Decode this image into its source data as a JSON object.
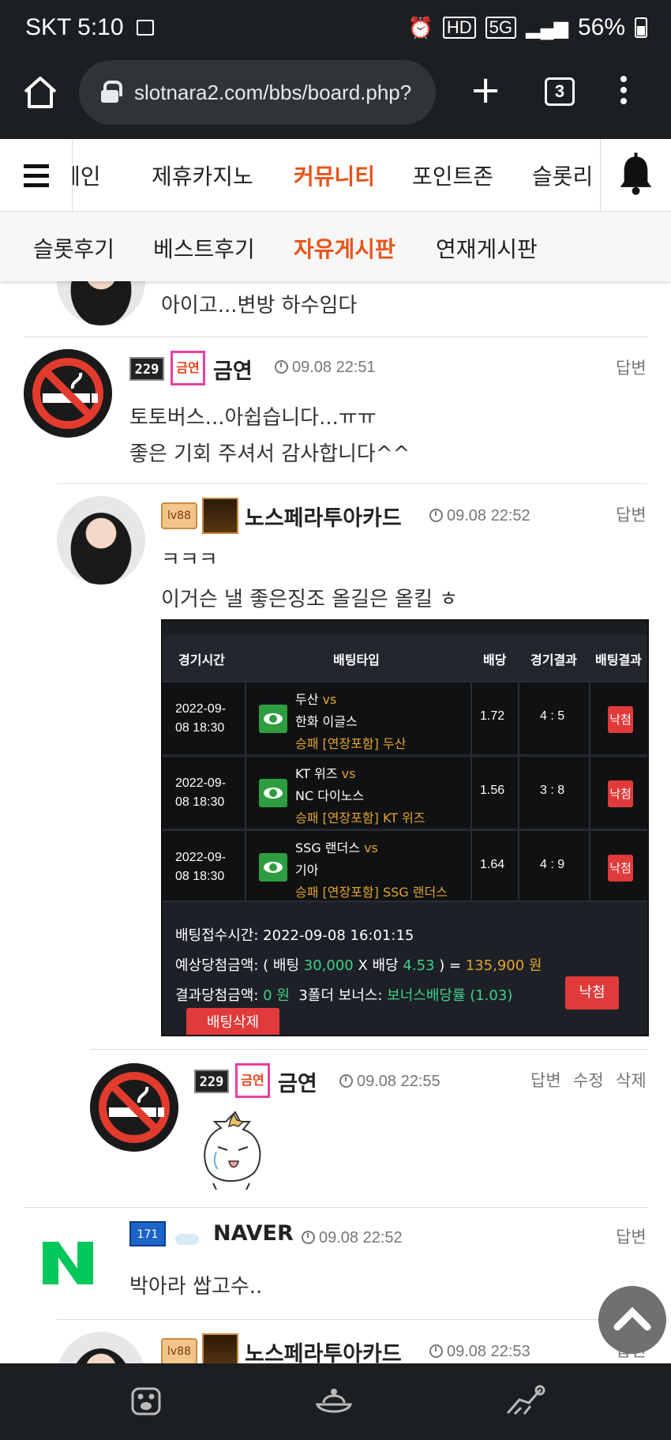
{
  "status_bar": {
    "carrier_time": "SKT 5:10",
    "hd_label": "HD",
    "network": "5G",
    "battery": "56%"
  },
  "browser": {
    "url": "slotnara2.com/bbs/board.php?",
    "tab_count": "3"
  },
  "site_nav": {
    "items": [
      {
        "label": "메인",
        "active": false
      },
      {
        "label": "제휴카지노",
        "active": false
      },
      {
        "label": "커뮤니티",
        "active": true
      },
      {
        "label": "포인트존",
        "active": false
      },
      {
        "label": "슬롯리",
        "active": false
      }
    ],
    "accent_color": "#e8541a"
  },
  "sub_nav": {
    "items": [
      {
        "label": "슬롯후기",
        "active": false
      },
      {
        "label": "베스트후기",
        "active": false
      },
      {
        "label": "자유게시판",
        "active": true
      },
      {
        "label": "연재게시판",
        "active": false
      }
    ]
  },
  "comments": [
    {
      "avatar": "girl-avatar",
      "text": "아이고...변방 하수임다"
    },
    {
      "avatar": "no-smoking-avatar",
      "level": "229",
      "badge": "금연",
      "nick": "금연",
      "time": "09.08 22:51",
      "actions": [
        "답변"
      ],
      "lines": [
        "토토버스...아쉽습니다...ㅠㅠ",
        "좋은 기회 주셔서 감사합니다^^"
      ]
    },
    {
      "avatar": "girl-avatar",
      "level": "lv88",
      "nick": "노스페라투아카드",
      "time": "09.08 22:52",
      "actions": [
        "답변"
      ],
      "lines": [
        "ㅋㅋㅋ",
        "이거슨 낼 좋은징조 올길은 올킬 ㅎ"
      ]
    },
    {
      "avatar": "no-smoking-avatar",
      "level": "229",
      "badge": "금연",
      "nick": "금연",
      "time": "09.08 22:55",
      "actions": [
        "답변",
        "수정",
        "삭제"
      ]
    },
    {
      "avatar": "naver-avatar",
      "level": "171",
      "nick": "NAVER",
      "time": "09.08 22:52",
      "actions": [
        "답변"
      ],
      "lines": [
        "박아라 쌉고수.."
      ]
    },
    {
      "avatar": "girl-avatar",
      "level": "lv88",
      "nick": "노스페라투아카드",
      "time": "09.08 22:53",
      "actions": [
        "답변"
      ]
    }
  ],
  "bet_slip": {
    "headers": [
      "경기시간",
      "배팅타입",
      "배당",
      "경기결과",
      "배팅결과"
    ],
    "rows": [
      {
        "date1": "2022-09-",
        "date2": "08 18:30",
        "home": "두산",
        "vs": "vs",
        "away": "한화 이글스",
        "pick": "승패 [연장포함] 두산",
        "odds": "1.72",
        "score": "4 : 5",
        "result": "낙첨"
      },
      {
        "date1": "2022-09-",
        "date2": "08 18:30",
        "home": "KT 위즈",
        "vs": "vs",
        "away": "NC 다이노스",
        "pick": "승패 [연장포함] KT 위즈",
        "odds": "1.56",
        "score": "3 : 8",
        "result": "낙첨"
      },
      {
        "date1": "2022-09-",
        "date2": "08 18:30",
        "home": "SSG 랜더스",
        "vs": "vs",
        "away": "기아",
        "pick": "승패 [연장포함] SSG 랜더스",
        "odds": "1.64",
        "score": "4 : 9",
        "result": "낙첨"
      }
    ],
    "received_label": "배팅접수시간:",
    "received_time": "2022-09-08 16:01:15",
    "expected_label": "예상당첨금액: ( 배팅",
    "stake": "30,000",
    "x_label": "X 배당",
    "total_odds": "4.53",
    "eq_label": ") =",
    "expected_win": "135,900 원",
    "result_label": "결과당첨금액:",
    "result_amount": "0 원",
    "bonus_label": "3폴더 보너스:",
    "bonus_value": "보너스배당률 (1.03)",
    "status_button": "낙첨",
    "delete_button": "배팅삭제"
  }
}
